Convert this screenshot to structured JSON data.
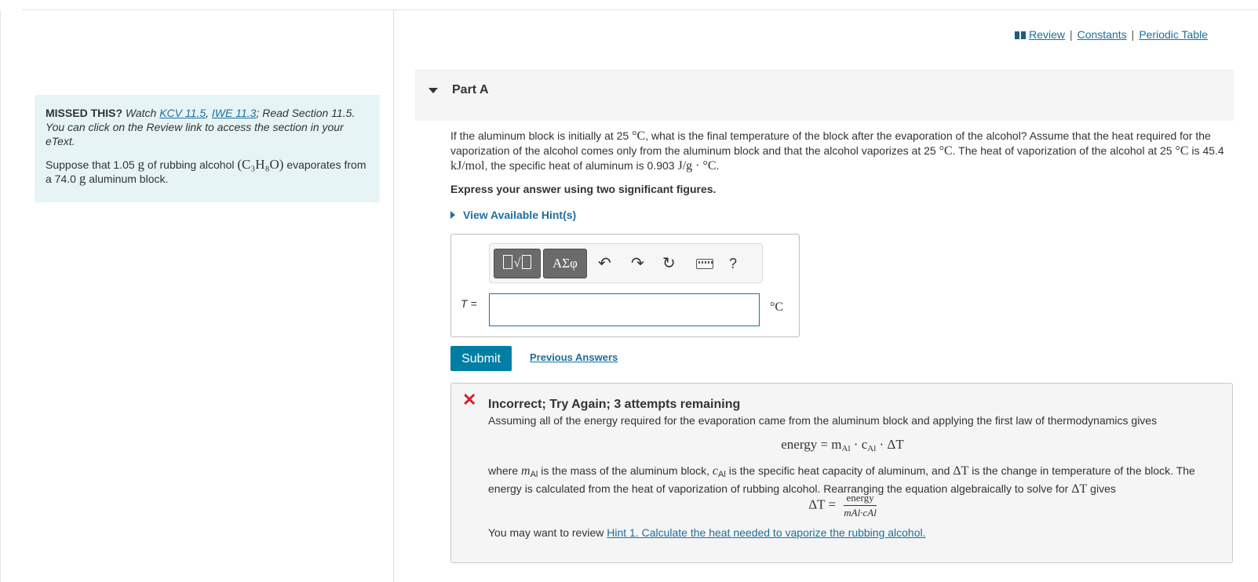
{
  "missed": {
    "lead_bold": "MISSED THIS?",
    "watch": " Watch ",
    "link1": "KCV 11.5",
    "comma": ", ",
    "link2": "IWE 11.3",
    "rest": "; Read Section 11.5. You can click on the Review link to access the section in your eText.",
    "question_pre": "Suppose that 1.05 ",
    "unit_g": "g",
    "question_mid": " of rubbing alcohol ",
    "formula": "(C₃H₈O)",
    "question_mid2": " evaporates from a 74.0 ",
    "question_end": " aluminum block."
  },
  "toplinks": {
    "review": "Review",
    "constants": "Constants",
    "periodic": "Periodic Table",
    "sep": "|"
  },
  "part": {
    "title": "Part A"
  },
  "question": {
    "line1_a": "If the aluminum block is initially at 25 ",
    "deg_c": "°C",
    "line1_b": ", what is the final temperature of the block after the evaporation of the alcohol? Assume that the heat required for the vaporization of the alcohol comes only from the aluminum block and that the alcohol vaporizes at 25 ",
    "line1_c": ". The heat of vaporization of the alcohol at 25 ",
    "line1_d": " is 45.4 ",
    "kjmol": "kJ/mol",
    "line1_e": ", the specific heat of aluminum is 0.903 ",
    "jg": "J/g · °C",
    "line1_f": "."
  },
  "express": "Express your answer using two significant figures.",
  "hints_label": "View Available Hint(s)",
  "toolbar": {
    "greek_label": "ΑΣφ",
    "help_label": "?"
  },
  "answer": {
    "var_label": "T =",
    "unit": "°C",
    "value": ""
  },
  "submit_label": "Submit",
  "previous_answers": "Previous Answers",
  "feedback": {
    "title": "Incorrect; Try Again; 3 attempts remaining",
    "p1": "Assuming all of the energy required for the evaporation came from the aluminum block and applying the first law of thermodynamics gives",
    "eq1": "energy = m",
    "eq1_rest": " · c",
    "eq1_end": " · ΔT",
    "sub_al": "Al",
    "p2_a": "where ",
    "p2_m": "m",
    "p2_b": " is the mass of the aluminum block, ",
    "p2_c": "c",
    "p2_d": " is the specific heat capacity of aluminum, and ",
    "p2_dt": "ΔT",
    "p2_e": " is the change in temperature of the block. The energy is calculated from the heat of vaporization of rubbing alcohol. Rearranging the equation algebraically to solve for ",
    "p2_f": " gives",
    "eq2_lhs": "ΔT = ",
    "eq2_num": "energy",
    "eq2_den": "mAl·cAl",
    "p3": "You may want to review ",
    "hint_link": "Hint 1. Calculate the heat needed to vaporize the rubbing alcohol."
  }
}
